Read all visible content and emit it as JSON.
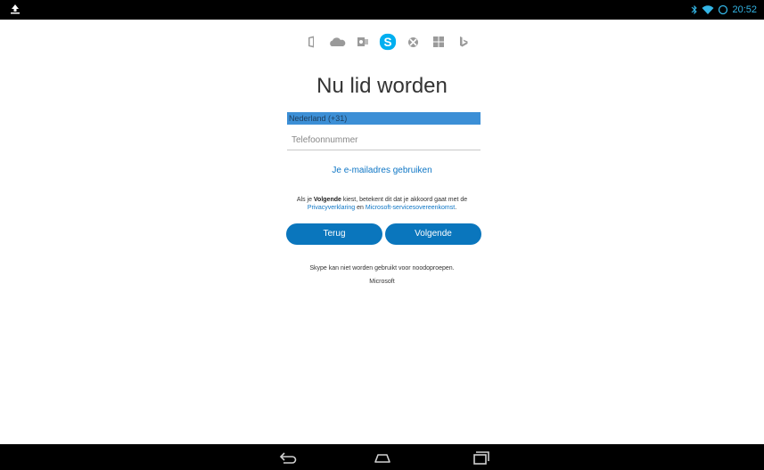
{
  "statusbar": {
    "time": "20:52",
    "left_icon": "upload-icon",
    "right_icons": [
      "bluetooth-icon",
      "wifi-icon",
      "sync-icon"
    ],
    "color": "#33b5e5"
  },
  "apps": [
    {
      "name": "office-icon",
      "active": false
    },
    {
      "name": "onedrive-icon",
      "active": false
    },
    {
      "name": "outlook-icon",
      "active": false
    },
    {
      "name": "skype-icon",
      "active": true
    },
    {
      "name": "xbox-icon",
      "active": false
    },
    {
      "name": "windows-icon",
      "active": false
    },
    {
      "name": "bing-icon",
      "active": false
    }
  ],
  "form": {
    "title": "Nu lid worden",
    "country_value": "Nederland (+31)",
    "phone_placeholder": "Telefoonnummer",
    "email_link": "Je e-mailadres gebruiken"
  },
  "legal": {
    "prefix": "Als je ",
    "bold": "Volgende",
    "middle": " kiest, betekent dit dat je akkoord gaat met de",
    "privacy_link": "Privacyverklaring",
    "and": " en ",
    "services_link": "Microsoft-servicesovereenkomst",
    "suffix": "."
  },
  "buttons": {
    "back": "Terug",
    "next": "Volgende"
  },
  "footer": {
    "note": "Skype kan niet worden gebruikt voor noodoproepen.",
    "company": "Microsoft"
  },
  "navbar": {
    "icons": [
      "back-icon",
      "home-icon",
      "recent-apps-icon"
    ]
  },
  "colors": {
    "accent": "#0a76bd",
    "link": "#0e76c5",
    "selection": "#3c8fd6",
    "skype": "#00aff0"
  }
}
